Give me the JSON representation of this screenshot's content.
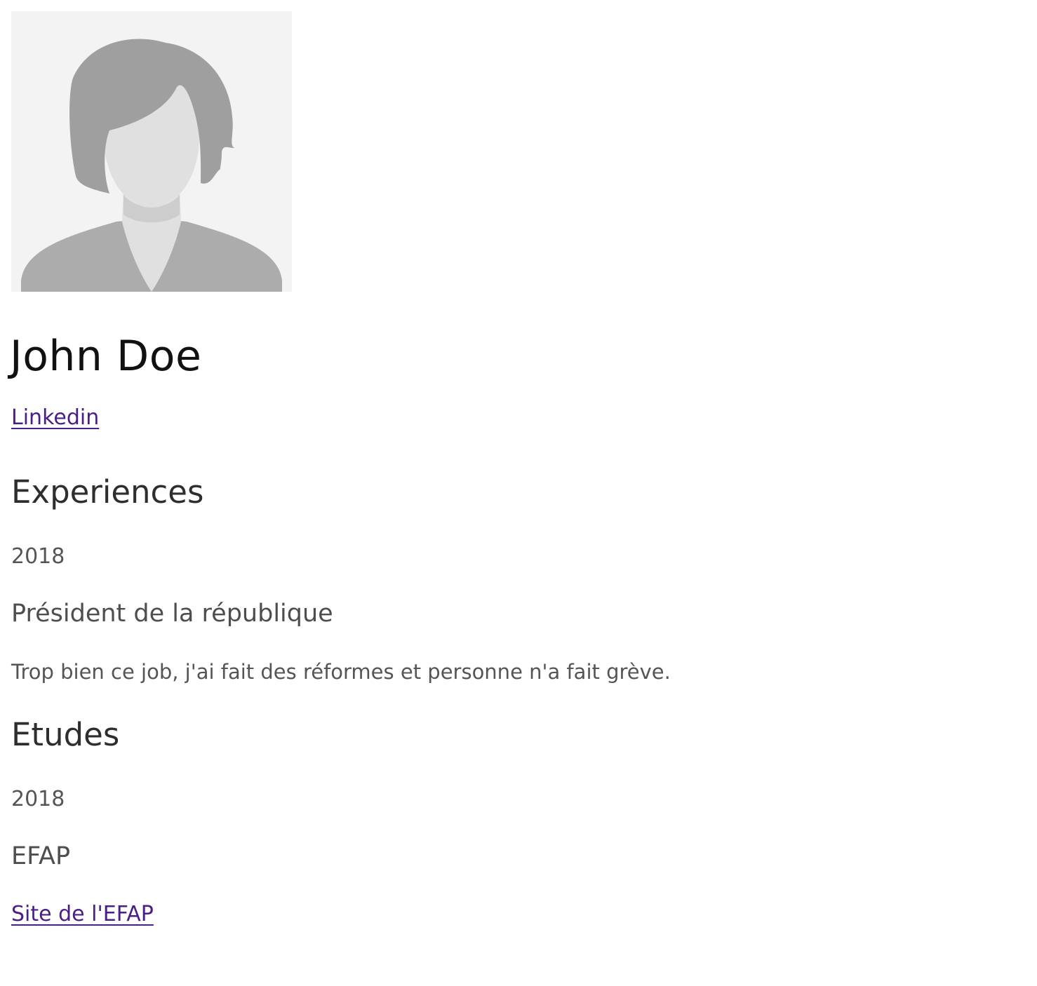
{
  "profile": {
    "name": "John Doe",
    "linkedin_label": "Linkedin"
  },
  "experiences": {
    "title": "Experiences",
    "items": [
      {
        "year": "2018",
        "role": "Président de la république",
        "description": "Trop bien ce job, j'ai fait des réformes et personne n'a fait grève."
      }
    ]
  },
  "studies": {
    "title": "Etudes",
    "items": [
      {
        "year": "2018",
        "school": "EFAP",
        "link_label": "Site de l'EFAP"
      }
    ]
  },
  "colors": {
    "link": "#4b1e87",
    "heading": "#2e2e2e",
    "text": "#555555",
    "avatar_bg": "#f3f3f3"
  }
}
